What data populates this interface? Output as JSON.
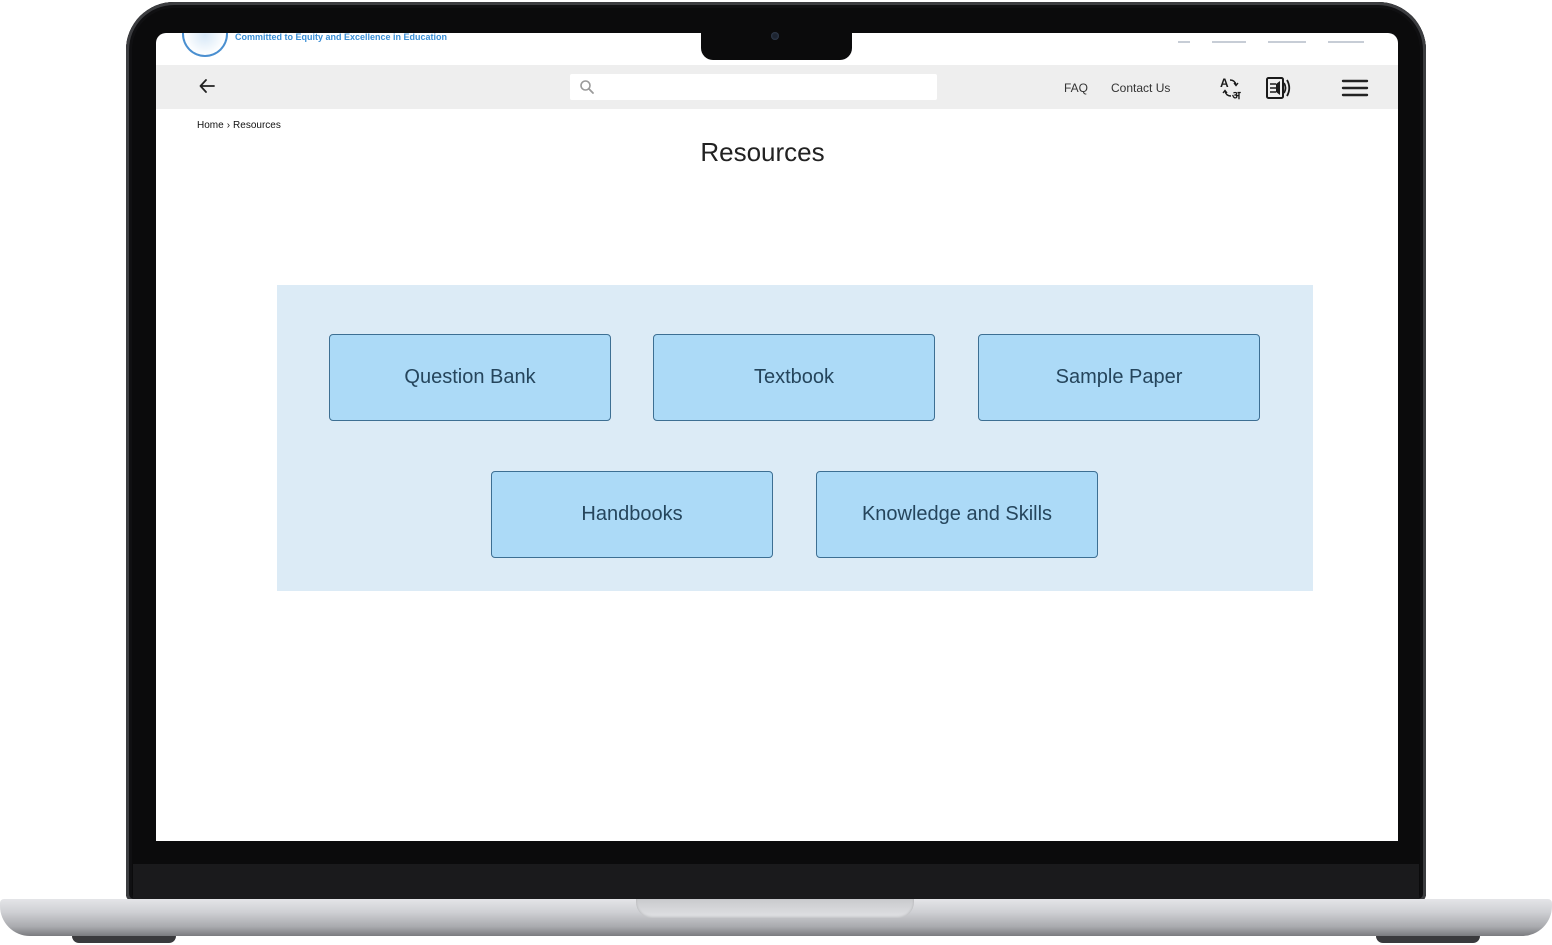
{
  "header": {
    "tagline": "Committed to Equity and Excellence in Education"
  },
  "toolbar": {
    "search_placeholder": "",
    "faq_label": "FAQ",
    "contact_label": "Contact Us",
    "icons": [
      "back-arrow-icon",
      "search-icon",
      "translate-icon",
      "read-aloud-icon",
      "hamburger-menu-icon"
    ]
  },
  "breadcrumb": {
    "home": "Home",
    "separator": "›",
    "current": "Resources"
  },
  "page": {
    "title": "Resources"
  },
  "resources": {
    "items": [
      {
        "label": "Question Bank"
      },
      {
        "label": "Textbook"
      },
      {
        "label": "Sample Paper"
      },
      {
        "label": "Handbooks"
      },
      {
        "label": "Knowledge and Skills"
      }
    ]
  },
  "colors": {
    "panel_bg": "#dcebf6",
    "button_bg": "#acdaf7",
    "button_border": "#3d6f93",
    "button_text": "#25455c",
    "toolbar_bg": "#eeeeee",
    "accent": "#3b8fd6"
  }
}
